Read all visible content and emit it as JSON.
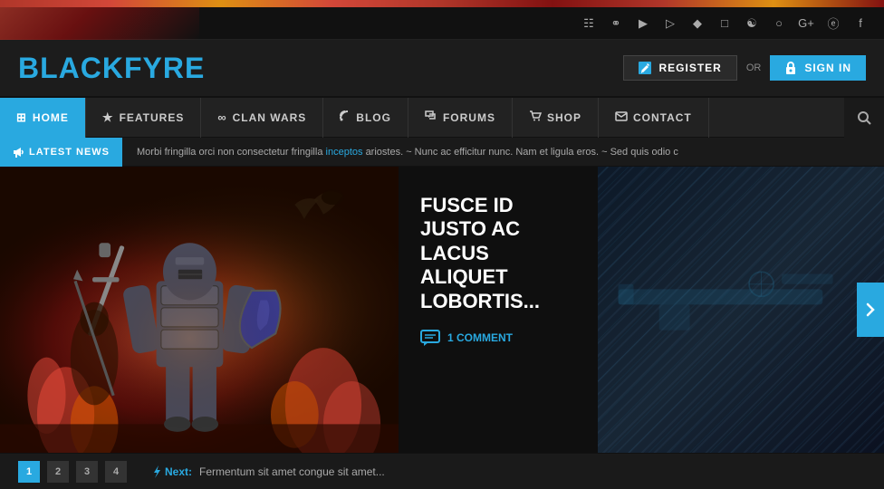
{
  "site": {
    "logo_black": "BLACK",
    "logo_blue": "FYRE"
  },
  "topbar": {
    "social_icons": [
      "rss",
      "dribbble",
      "vimeo",
      "youtube",
      "twitch",
      "instagram",
      "swirl",
      "pinterest",
      "google-plus",
      "twitter",
      "facebook"
    ]
  },
  "header": {
    "register_label": "REGISTER",
    "or_label": "OR",
    "signin_label": "SIGN IN"
  },
  "nav": {
    "items": [
      {
        "label": "HOME",
        "icon": "⊞",
        "active": true
      },
      {
        "label": "FEATURES",
        "icon": "★"
      },
      {
        "label": "CLAN WARS",
        "icon": "∞"
      },
      {
        "label": "BLOG",
        "icon": "☰"
      },
      {
        "label": "FORUMS",
        "icon": "👥"
      },
      {
        "label": "SHOP",
        "icon": "🛒"
      },
      {
        "label": "CONTACT",
        "icon": "✉"
      }
    ]
  },
  "latest_news": {
    "label": "LATEST NEWS",
    "ticker": "Morbi fringilla orci non consectetur fringilla",
    "ticker_link": "inceptos",
    "ticker_rest": "ariostes. ~ Nunc ac efficitur nunc. Nam et ligula eros. ~ Sed quis odio c"
  },
  "hero": {
    "title": "FUSCE ID JUSTO AC LACUS ALIQUET LOBORTIS...",
    "comments_count": "1 COMMENT"
  },
  "bottom_bar": {
    "slides": [
      "1",
      "2",
      "3",
      "4"
    ],
    "next_label": "Next:",
    "next_text": "Fermentum sit amet congue sit amet..."
  }
}
